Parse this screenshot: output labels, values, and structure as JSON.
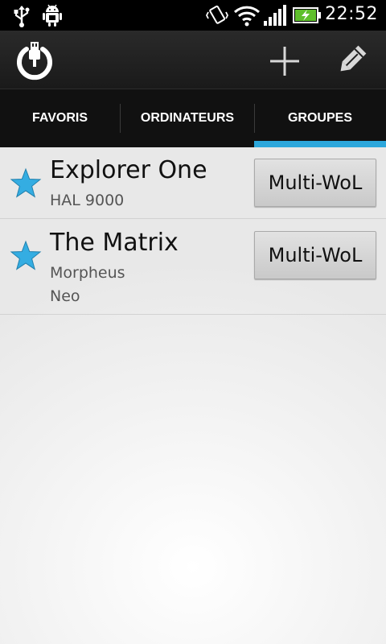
{
  "status_bar": {
    "time": "22:52",
    "icons": [
      "usb-icon",
      "android-debug-icon",
      "vibrate-icon",
      "wifi-icon",
      "signal-icon",
      "battery-charging-icon"
    ]
  },
  "action_bar": {
    "app_icon": "power-usb-icon",
    "actions": [
      "add-icon",
      "edit-icon"
    ]
  },
  "tabs": [
    {
      "label": "FAVORIS",
      "selected": false
    },
    {
      "label": "ORDINATEURS",
      "selected": false
    },
    {
      "label": "GROUPES",
      "selected": true
    }
  ],
  "accent_color": "#2ca7dc",
  "groups": [
    {
      "name": "Explorer One",
      "members": [
        "HAL 9000"
      ],
      "favorite": true,
      "button": "Multi-WoL"
    },
    {
      "name": "The Matrix",
      "members": [
        "Morpheus",
        "Neo"
      ],
      "favorite": true,
      "button": "Multi-WoL"
    }
  ]
}
